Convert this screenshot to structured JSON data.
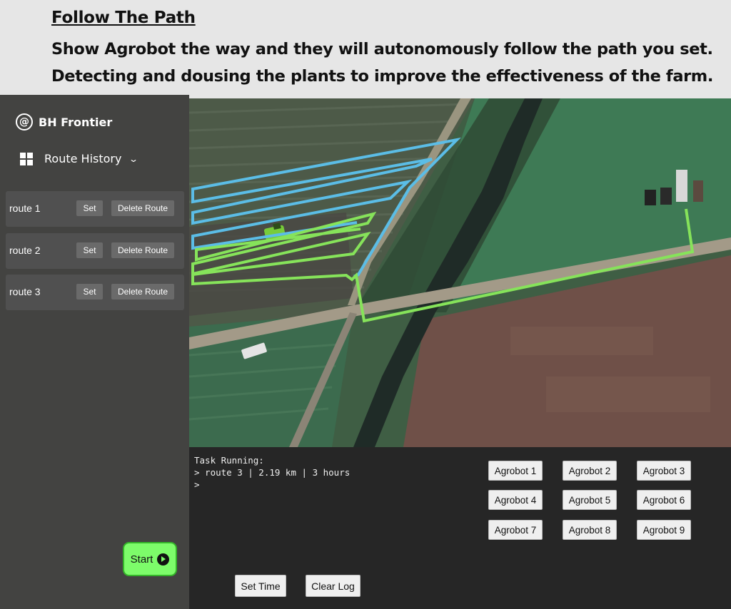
{
  "caption": {
    "title": "Follow The Path",
    "line1": "Show Agrobot the way and they will autonomously follow the path you set.",
    "line2": "Detecting and dousing the plants to improve the effectiveness of the farm."
  },
  "sidebar": {
    "brand": "BH Frontier",
    "brand_icon": "at-sign-icon",
    "section_title": "Route History",
    "routes": [
      {
        "name": "route 1",
        "set_label": "Set",
        "delete_label": "Delete Route"
      },
      {
        "name": "route 2",
        "set_label": "Set",
        "delete_label": "Delete Route"
      },
      {
        "name": "route 3",
        "set_label": "Set",
        "delete_label": "Delete Route"
      }
    ],
    "start_label": "Start"
  },
  "map": {
    "route_colors": {
      "blue": "#5bbde6",
      "green": "#86e35a"
    }
  },
  "console": {
    "log_line1": "Task Running:",
    "log_line2": "> route 3 | 2.19 km | 3 hours",
    "log_line3": ">",
    "agrobots": [
      "Agrobot 1",
      "Agrobot 2",
      "Agrobot 3",
      "Agrobot 4",
      "Agrobot 5",
      "Agrobot 6",
      "Agrobot 7",
      "Agrobot 8",
      "Agrobot 9"
    ],
    "set_time_label": "Set Time",
    "clear_log_label": "Clear Log"
  }
}
